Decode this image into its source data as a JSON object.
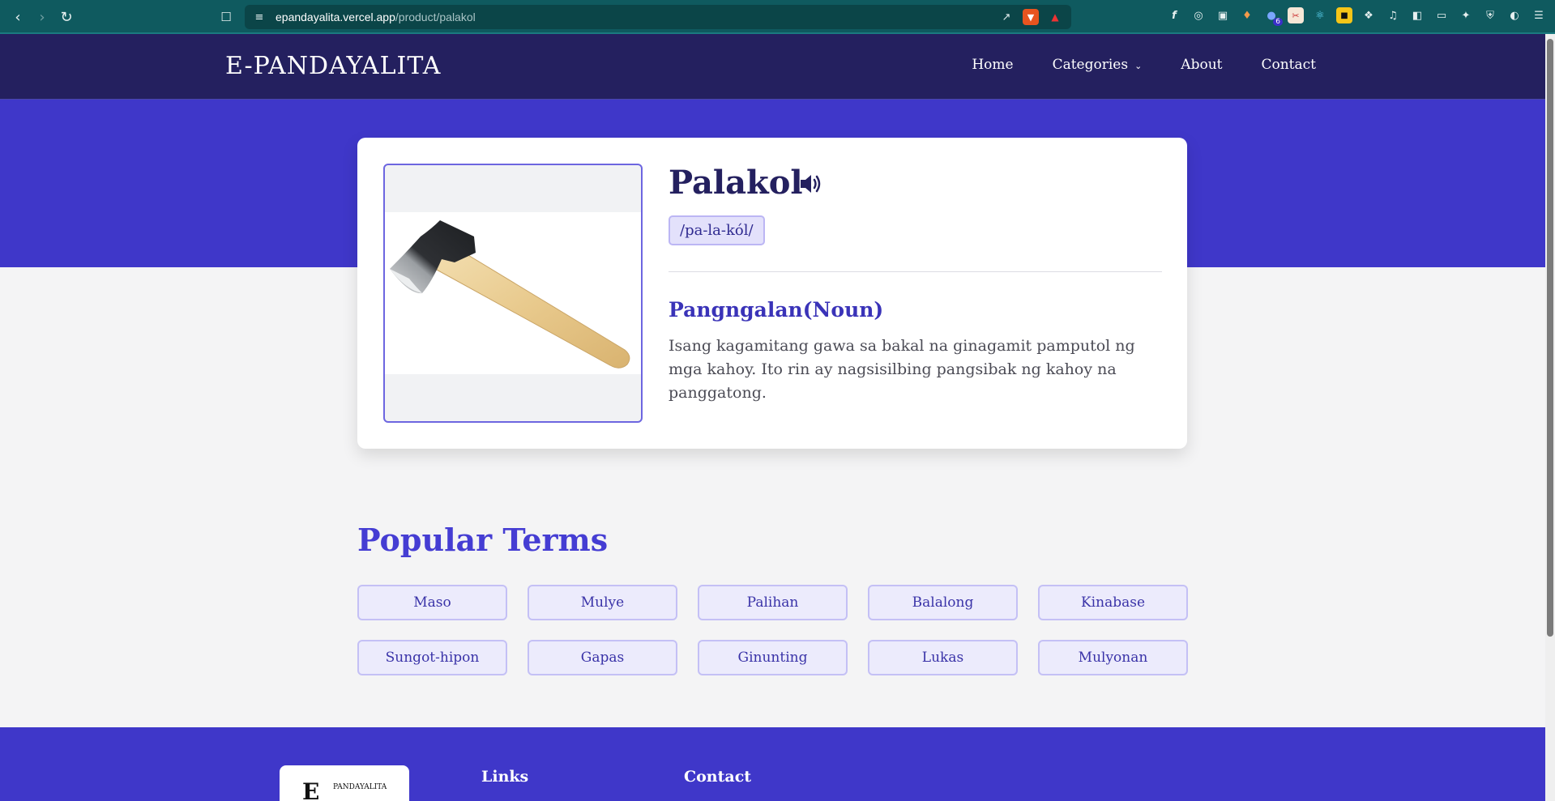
{
  "browser": {
    "url_domain": "epandayalita.vercel.app",
    "url_path": "/product/palakol",
    "extension_badge": "6"
  },
  "header": {
    "logo": "E-PANDAYALITA",
    "nav": {
      "home": "Home",
      "categories": "Categories",
      "about": "About",
      "contact": "Contact"
    }
  },
  "product": {
    "word": "Palakol",
    "pronunciation": "/pa-la-kól/",
    "part_of_speech": "Pangngalan(Noun)",
    "definition": "Isang kagamitang gawa sa bakal na ginagamit pamputol ng mga kahoy. Ito rin ay nagsisilbing pangsibak ng kahoy na panggatong."
  },
  "popular": {
    "title": "Popular Terms",
    "terms": [
      "Maso",
      "Mulye",
      "Palihan",
      "Balalong",
      "Kinabase",
      "Sungot-hipon",
      "Gapas",
      "Ginunting",
      "Lukas",
      "Mulyonan"
    ]
  },
  "footer": {
    "logo_small": "PANDAYALITA",
    "links_title": "Links",
    "contact_title": "Contact"
  },
  "colors": {
    "header_bg": "#24205f",
    "hero_bg": "#3f37c9",
    "accent": "#453dd3",
    "chrome_bg": "#0f5a5f"
  }
}
